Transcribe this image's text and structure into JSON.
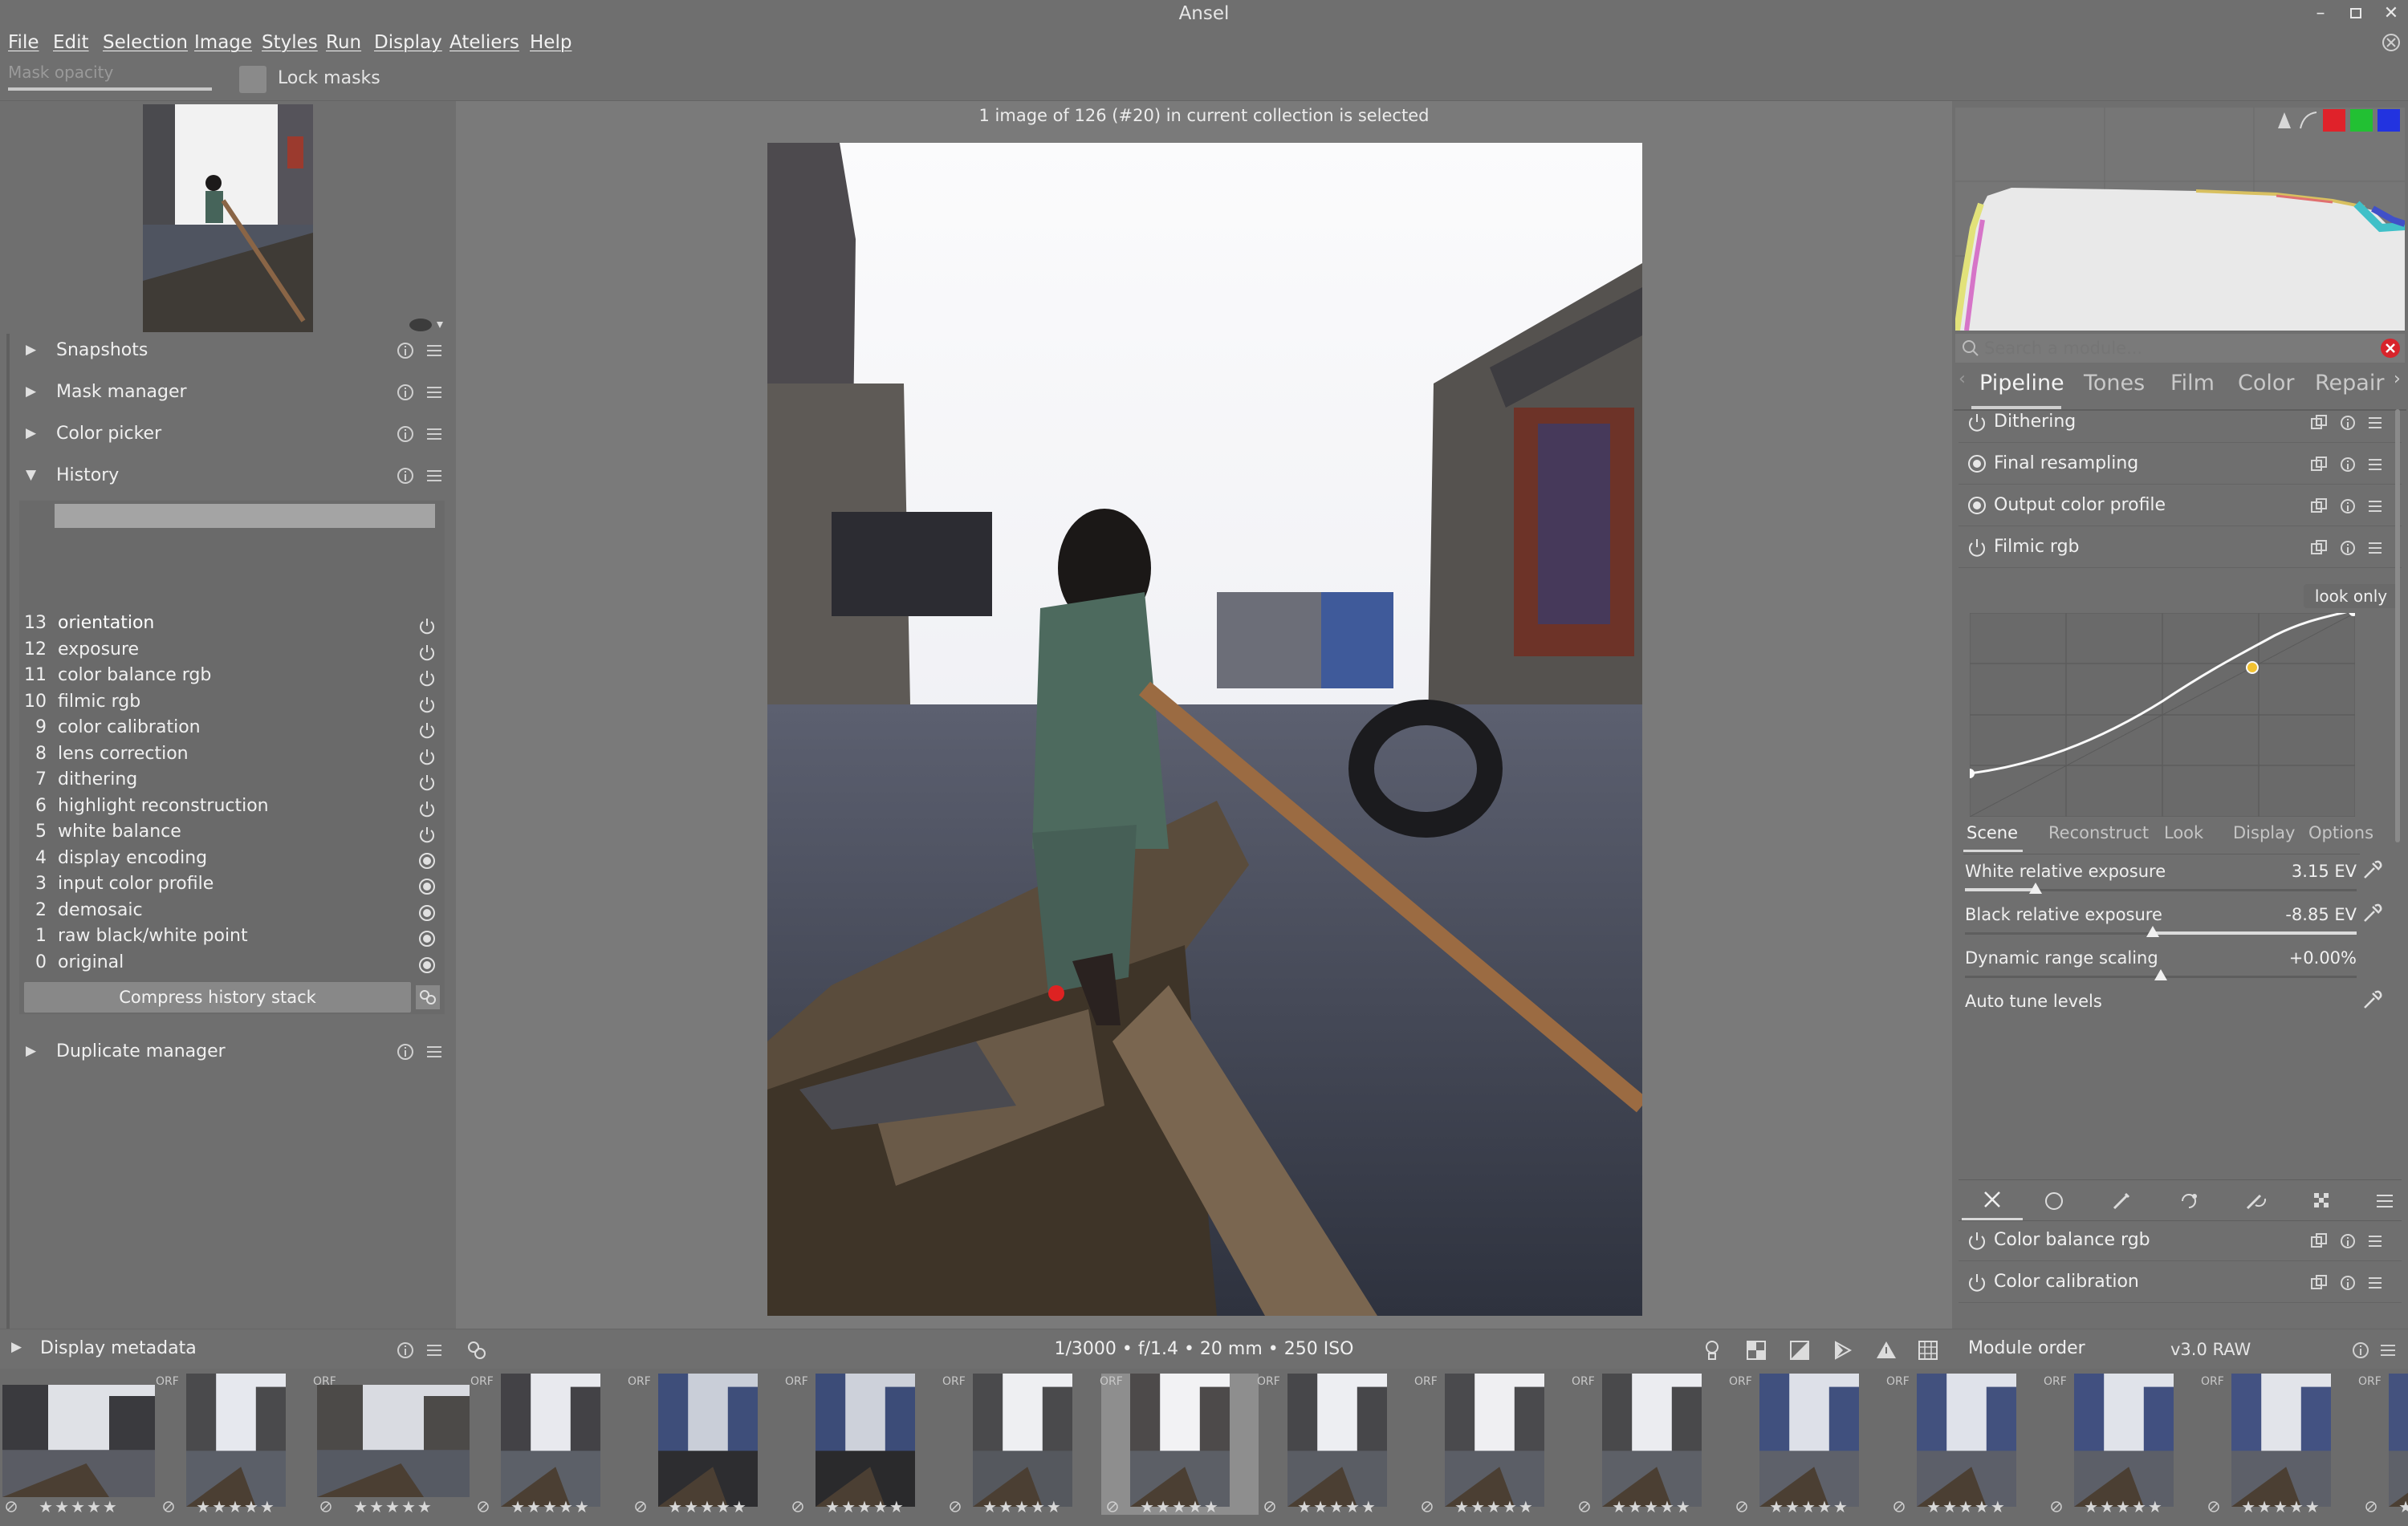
{
  "window": {
    "title": "Ansel"
  },
  "menu": [
    "File",
    "Edit",
    "Selection",
    "Image",
    "Styles",
    "Run",
    "Display",
    "Ateliers",
    "Help"
  ],
  "maskbar": {
    "opacity_label": "Mask opacity",
    "lock_label": "Lock masks"
  },
  "left": {
    "snapshots": "Snapshots",
    "mask_manager": "Mask manager",
    "color_picker": "Color picker",
    "history": "History",
    "history_items": [
      {
        "n": "13",
        "name": "orientation",
        "state": "power"
      },
      {
        "n": "12",
        "name": "exposure",
        "state": "power"
      },
      {
        "n": "11",
        "name": "color balance rgb",
        "state": "power"
      },
      {
        "n": "10",
        "name": "filmic rgb",
        "state": "power"
      },
      {
        "n": "9",
        "name": "color calibration",
        "state": "power"
      },
      {
        "n": "8",
        "name": "lens correction",
        "state": "power"
      },
      {
        "n": "7",
        "name": "dithering",
        "state": "power"
      },
      {
        "n": "6",
        "name": "highlight reconstruction",
        "state": "power"
      },
      {
        "n": "5",
        "name": "white balance",
        "state": "power"
      },
      {
        "n": "4",
        "name": "display encoding",
        "state": "always"
      },
      {
        "n": "3",
        "name": "input color profile",
        "state": "always"
      },
      {
        "n": "2",
        "name": "demosaic",
        "state": "always"
      },
      {
        "n": "1",
        "name": "raw black/white point",
        "state": "always"
      },
      {
        "n": "0",
        "name": "original",
        "state": "always"
      }
    ],
    "compress": "Compress history stack",
    "duplicate_manager": "Duplicate manager",
    "display_metadata": "Display metadata"
  },
  "center": {
    "selection_info": "1 image of 126 (#20) in current collection is selected",
    "exif": "1/3000 • f/1.4 • 20 mm • 250 ISO"
  },
  "right": {
    "search_placeholder": "Search a module...",
    "tabs": [
      "Pipeline",
      "Tones",
      "Film",
      "Color",
      "Repair"
    ],
    "active_tab": "Pipeline",
    "modules_top": [
      "Dithering",
      "Final resampling",
      "Output color profile",
      "Filmic rgb"
    ],
    "look_only": "look only",
    "filmic_tabs": [
      "Scene",
      "Reconstruct",
      "Look",
      "Display",
      "Options"
    ],
    "sliders": [
      {
        "label": "White relative exposure",
        "value": "3.15 EV",
        "level": 0.18
      },
      {
        "label": "Black relative exposure",
        "value": "-8.85 EV",
        "level": 0.48
      },
      {
        "label": "Dynamic range scaling",
        "value": "+0.00%",
        "level": 0.5
      }
    ],
    "auto_tune": "Auto tune levels",
    "modules_bottom": [
      "Color balance rgb",
      "Color calibration"
    ],
    "module_order_label": "Module order",
    "module_order_value": "v3.0 RAW"
  },
  "filmstrip": {
    "count": 16,
    "selected_index": 7,
    "raw_label": "ORF",
    "star_glyphs": "★★★★★"
  },
  "colors": {
    "histogram_red": "#e0222a",
    "histogram_green": "#22c033",
    "histogram_blue": "#2233e0",
    "close_red": "#d8242b",
    "panel": "#6f6f6f",
    "center": "#7a7a7a"
  }
}
